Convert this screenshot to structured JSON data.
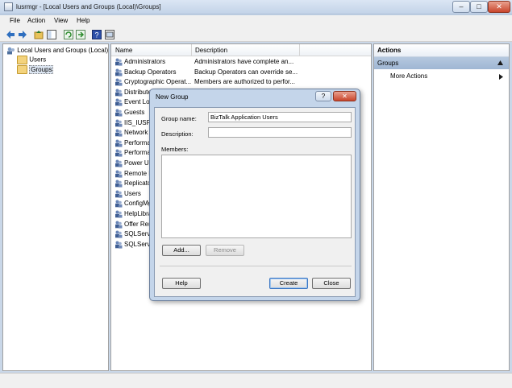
{
  "window": {
    "title": "lusrmgr - [Local Users and Groups (Local)\\Groups]",
    "minimize_glyph": "–",
    "maximize_glyph": "□",
    "close_glyph": "✕"
  },
  "menu": [
    "File",
    "Action",
    "View",
    "Help"
  ],
  "toolbar_icons": [
    "back-icon",
    "forward-icon",
    "up-folder-icon",
    "show-hide-tree-icon",
    "refresh-icon",
    "export-list-icon",
    "help-icon",
    "properties-icon"
  ],
  "tree": {
    "root": "Local Users and Groups (Local)",
    "items": [
      "Users",
      "Groups"
    ]
  },
  "list": {
    "columns": [
      "Name",
      "Description"
    ],
    "rows": [
      {
        "name": "Administrators",
        "desc": "Administrators have complete an..."
      },
      {
        "name": "Backup Operators",
        "desc": "Backup Operators can override se..."
      },
      {
        "name": "Cryptographic Operat...",
        "desc": "Members are authorized to perfor..."
      },
      {
        "name": "Distribute",
        "desc": ""
      },
      {
        "name": "Event Log",
        "desc": ""
      },
      {
        "name": "Guests",
        "desc": ""
      },
      {
        "name": "IIS_IUSRS",
        "desc": ""
      },
      {
        "name": "Network C",
        "desc": ""
      },
      {
        "name": "Performan",
        "desc": ""
      },
      {
        "name": "Performan",
        "desc": ""
      },
      {
        "name": "Power Use",
        "desc": ""
      },
      {
        "name": "Remote D",
        "desc": ""
      },
      {
        "name": "Replicator",
        "desc": ""
      },
      {
        "name": "Users",
        "desc": ""
      },
      {
        "name": "ConfigMg",
        "desc": ""
      },
      {
        "name": "HelpLibra",
        "desc": ""
      },
      {
        "name": "Offer Rem",
        "desc": ""
      },
      {
        "name": "SQLServe",
        "desc": ""
      },
      {
        "name": "SQLServe",
        "desc": ""
      }
    ]
  },
  "actions": {
    "title": "Actions",
    "section": "Groups",
    "more": "More Actions"
  },
  "dialog": {
    "title": "New Group",
    "help_glyph": "?",
    "close_glyph": "✕",
    "group_name_label": "Group name:",
    "group_name_value": "BizTalk Application Users",
    "description_label": "Description:",
    "description_value": "",
    "members_label": "Members:",
    "add_label": "Add...",
    "remove_label": "Remove",
    "help_label": "Help",
    "create_label": "Create",
    "close_label": "Close"
  }
}
